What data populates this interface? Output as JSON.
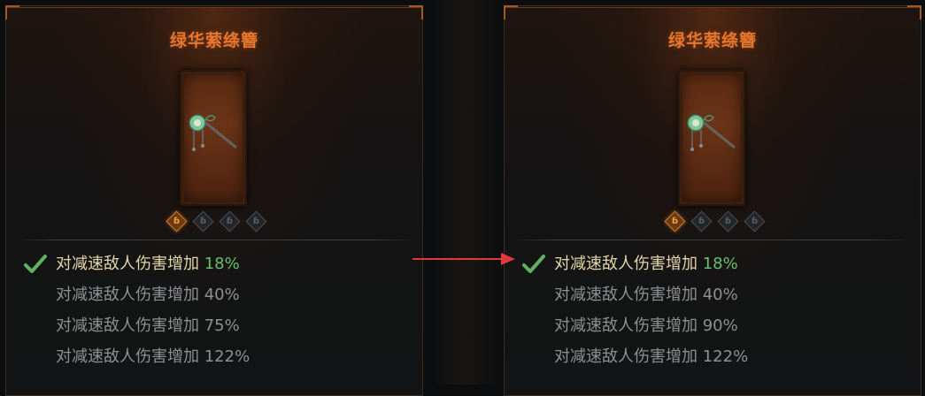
{
  "panels": [
    {
      "title": "绿华萦绦簪",
      "effects": [
        {
          "label": "对减速敌人伤害增加",
          "value": "18%",
          "active": true
        },
        {
          "label": "对减速敌人伤害增加",
          "value": "40%",
          "active": false
        },
        {
          "label": "对减速敌人伤害增加",
          "value": "75%",
          "active": false
        },
        {
          "label": "对减速敌人伤害增加",
          "value": "122%",
          "active": false
        }
      ],
      "gems": [
        "on",
        "off",
        "off",
        "off"
      ]
    },
    {
      "title": "绿华萦绦簪",
      "effects": [
        {
          "label": "对减速敌人伤害增加",
          "value": "18%",
          "active": true
        },
        {
          "label": "对减速敌人伤害增加",
          "value": "40%",
          "active": false
        },
        {
          "label": "对减速敌人伤害增加",
          "value": "90%",
          "active": false
        },
        {
          "label": "对减速敌人伤害增加",
          "value": "122%",
          "active": false
        }
      ],
      "gems": [
        "on",
        "off",
        "off",
        "off"
      ]
    }
  ],
  "colors": {
    "title": "#e8772e",
    "active_text": "#e3d6a8",
    "active_value": "#67c06a",
    "inactive_text": "#8d9094",
    "arrow": "#e23a3a"
  },
  "icons": {
    "check": "check-icon",
    "gem": "rune-slot-icon",
    "item": "hairpin-icon",
    "arrow": "arrow-right-icon"
  }
}
